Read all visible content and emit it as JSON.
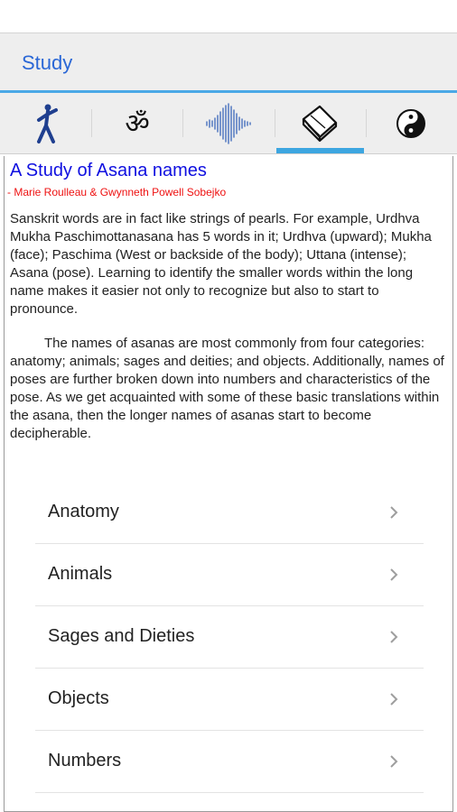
{
  "appbar": {
    "title": "Study"
  },
  "tabs": [
    {
      "icon": "yoga-pose-icon",
      "active": false
    },
    {
      "icon": "om-icon",
      "active": false
    },
    {
      "icon": "sound-wave-icon",
      "active": false
    },
    {
      "icon": "book-icon",
      "active": true
    },
    {
      "icon": "yin-yang-icon",
      "active": false
    }
  ],
  "article": {
    "title": "A Study of Asana names",
    "author": "- Marie Roulleau & Gwynneth Powell Sobejko",
    "paragraph1": "Sanskrit words are in fact like strings of pearls. For example, Urdhva Mukha Paschimottanasana has 5 words in it; Urdhva (upward); Mukha (face); Paschima (West or backside of the body); Uttana (intense); Asana (pose). Learning to identify the smaller words within the long name makes it easier not only to recognize but also to start to pronounce.  ",
    "paragraph2": "The names of asanas are most commonly from four categories: anatomy; animals; sages and deities; and objects. Additionally, names of poses are further broken down into numbers and characteristics of the pose. As we get acquainted with some of these basic translations within the asana, then the longer names of asanas start to become decipherable."
  },
  "menu": [
    {
      "label": "Anatomy"
    },
    {
      "label": "Animals"
    },
    {
      "label": "Sages and Dieties"
    },
    {
      "label": "Objects"
    },
    {
      "label": "Numbers"
    }
  ]
}
